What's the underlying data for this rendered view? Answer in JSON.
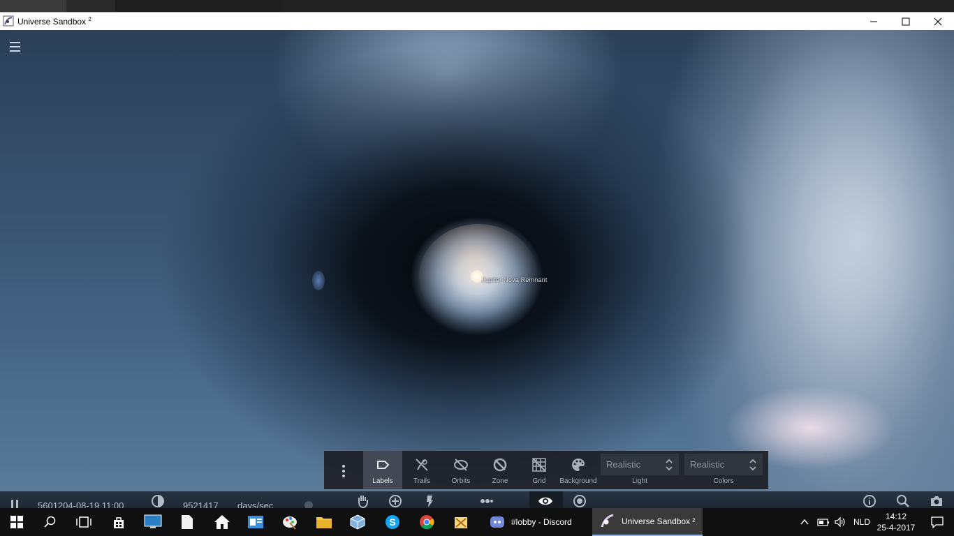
{
  "window": {
    "title": "Universe Sandbox",
    "title_superscript": "2"
  },
  "viewport": {
    "object_label": "Jupiter Nova Remnant"
  },
  "view_toolbar": {
    "tools": [
      {
        "label": "Labels",
        "icon": "label-tag-icon",
        "active": true
      },
      {
        "label": "Trails",
        "icon": "trails-off-icon",
        "active": false
      },
      {
        "label": "Orbits",
        "icon": "orbits-off-icon",
        "active": false
      },
      {
        "label": "Zone",
        "icon": "zone-off-icon",
        "active": false
      },
      {
        "label": "Grid",
        "icon": "grid-off-icon",
        "active": false
      },
      {
        "label": "Background",
        "icon": "palette-icon",
        "active": false
      }
    ],
    "light": {
      "value": "Realistic",
      "label": "Light"
    },
    "colors": {
      "value": "Realistic",
      "label": "Colors"
    }
  },
  "sim_bar": {
    "date": "5601204-08-19 11:00",
    "speed_value": "9521417",
    "speed_unit": "days/sec",
    "icons": [
      "pause-icon",
      "time-dial-icon",
      "hand-icon",
      "add-icon",
      "power-icon",
      "chain-icon",
      "eye-icon",
      "sim-target-icon",
      "info-icon",
      "search-icon",
      "camera-icon"
    ]
  },
  "taskbar": {
    "pinned_icons": [
      "start-icon",
      "search-icon",
      "task-view-icon",
      "store-icon",
      "lenovo-icon",
      "file-icon",
      "home-icon",
      "outlook-icon",
      "paint-icon",
      "explorer-icon",
      "virtualbox-icon",
      "skype-icon",
      "chrome-icon",
      "utility-icon"
    ],
    "tasks": [
      {
        "label": "#lobby - Discord",
        "icon": "discord-icon",
        "active": false
      },
      {
        "label": "Universe Sandbox ²",
        "icon": "universe-sandbox-icon",
        "active": true
      }
    ],
    "tray": {
      "language": "NLD",
      "time": "14:12",
      "date": "25-4-2017"
    }
  },
  "colors": {
    "accent": "#f0a84c",
    "toolbar_bg": "#1c2026",
    "active_tool_bg": "#464e5a"
  }
}
